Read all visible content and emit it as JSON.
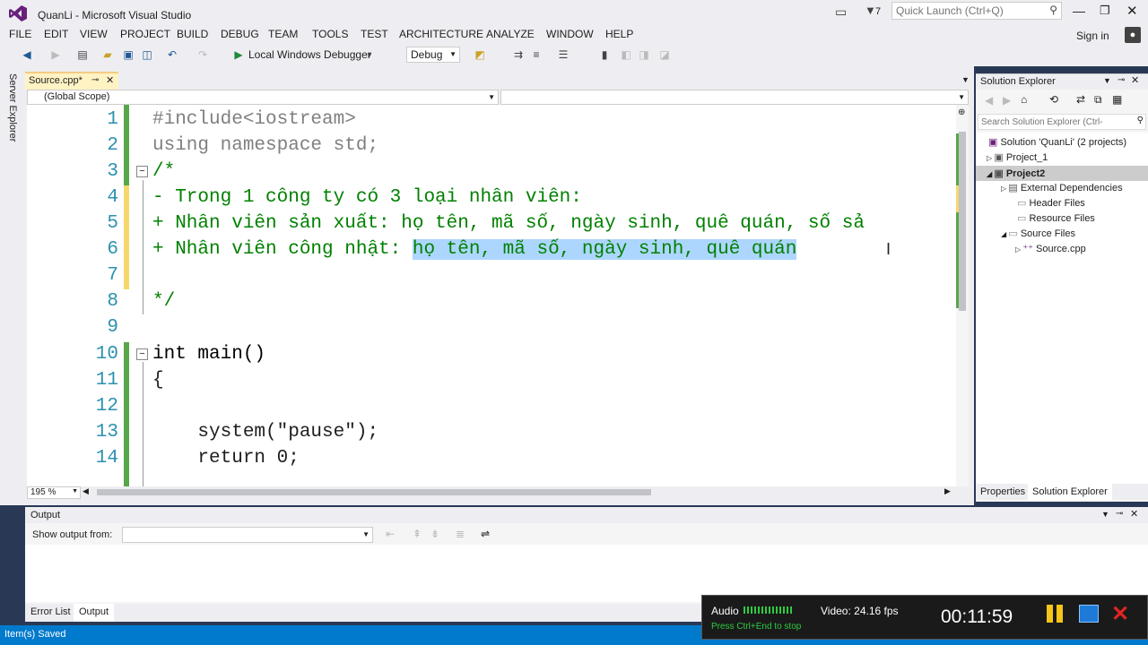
{
  "window": {
    "title": "QuanLi - Microsoft Visual Studio",
    "notif_count": "7",
    "quick_launch_placeholder": "Quick Launch (Ctrl+Q)",
    "sign_in": "Sign in"
  },
  "menu": [
    "FILE",
    "EDIT",
    "VIEW",
    "PROJECT",
    "BUILD",
    "DEBUG",
    "TEAM",
    "TOOLS",
    "TEST",
    "ARCHITECTURE",
    "ANALYZE",
    "WINDOW",
    "HELP"
  ],
  "toolbar": {
    "debugger_label": "Local Windows Debugger",
    "config": "Debug"
  },
  "side_tab": "Server Explorer",
  "editor": {
    "tab_label": "Source.cpp*",
    "scope": "(Global Scope)",
    "zoom": "195 %",
    "lines": [
      {
        "n": "1",
        "text": "#include<iostream>"
      },
      {
        "n": "2",
        "text": "using namespace std;"
      },
      {
        "n": "3",
        "text": "/*"
      },
      {
        "n": "4",
        "text": "- Trong 1 công ty có 3 loại nhân viên:"
      },
      {
        "n": "5",
        "text": "+ Nhân viên sản xuất: họ tên, mã số, ngày sinh, quê quán, số sả"
      },
      {
        "n": "6",
        "text": "+ Nhân viên công nhật: ",
        "sel": "họ tên, mã số, ngày sinh, quê quán"
      },
      {
        "n": "7",
        "text": ""
      },
      {
        "n": "8",
        "text": "*/"
      },
      {
        "n": "9",
        "text": ""
      },
      {
        "n": "10",
        "text": "int main()"
      },
      {
        "n": "11",
        "text": "{"
      },
      {
        "n": "12",
        "text": ""
      },
      {
        "n": "13",
        "text": "    system(\"pause\");"
      },
      {
        "n": "14",
        "text": "    return 0;"
      }
    ]
  },
  "solution_explorer": {
    "title": "Solution Explorer",
    "search_placeholder": "Search Solution Explorer (Ctrl-",
    "items": [
      "Solution 'QuanLi' (2 projects)",
      "Project_1",
      "Project2",
      "External Dependencies",
      "Header Files",
      "Resource Files",
      "Source Files",
      "Source.cpp"
    ],
    "tab_properties": "Properties",
    "tab_solution_explorer": "Solution Explorer"
  },
  "output": {
    "title": "Output",
    "show_from_label": "Show output from:",
    "tab_error_list": "Error List",
    "tab_output": "Output"
  },
  "status": {
    "text": "Item(s) Saved"
  },
  "recorder": {
    "audio": "Audio",
    "video": "Video: 24.16 fps",
    "hint": "Press Ctrl+End to stop",
    "time": "00:11:59"
  },
  "colors": {
    "accent": "#007acc",
    "selection": "#add6ff",
    "keyword": "#0000ff",
    "comment": "#008000",
    "string": "#a31515",
    "preproc": "#808080"
  }
}
